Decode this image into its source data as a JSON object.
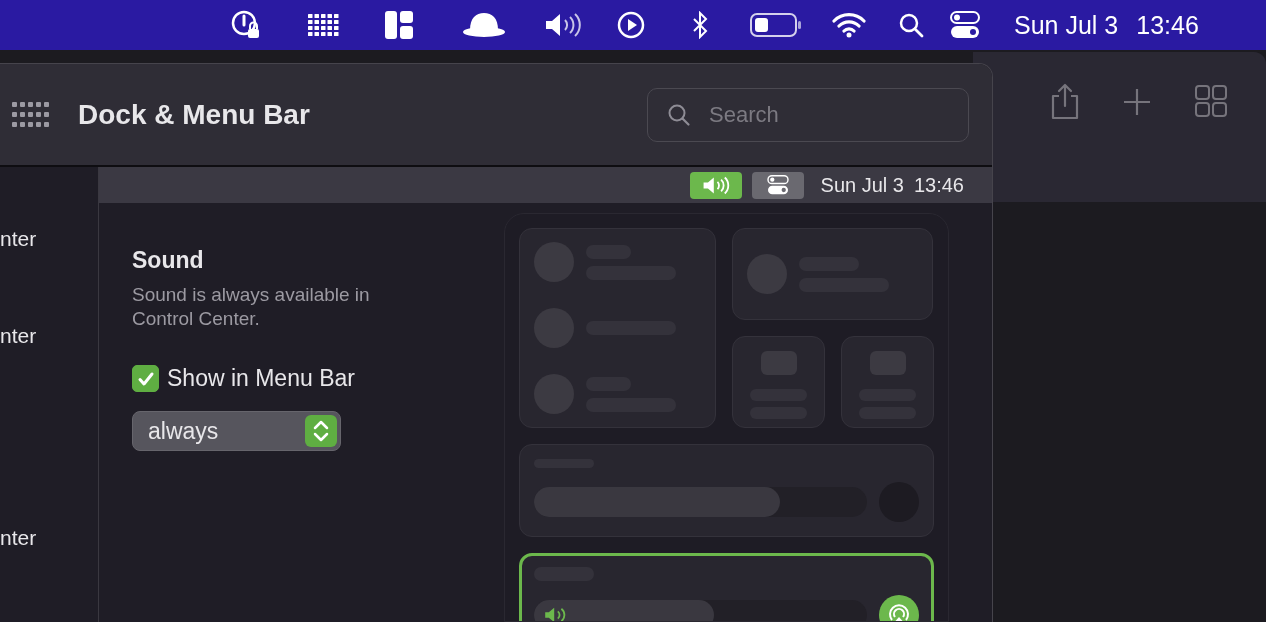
{
  "menu_bar": {
    "date": "Sun Jul 3",
    "time": "13:46"
  },
  "window": {
    "title": "Dock & Menu Bar",
    "search": {
      "placeholder": "Search"
    }
  },
  "sidebar_items": [
    {
      "label": "nter"
    },
    {
      "label": "nter"
    },
    {
      "label": "nter"
    }
  ],
  "preview_menu_bar": {
    "items": [
      {
        "kind": "sound",
        "selected": true
      },
      {
        "kind": "control-center",
        "selected": false
      }
    ],
    "date": "Sun Jul 3",
    "time": "13:46"
  },
  "section": {
    "title": "Sound",
    "description": "Sound is always available in Control Center.",
    "checkbox": {
      "label": "Show in Menu Bar",
      "checked": true
    },
    "popup": {
      "value": "always"
    }
  },
  "control_center_preview": {
    "display_slider": {
      "level": 0.74
    },
    "sound_module": {
      "selected": true,
      "level": 0.54
    }
  }
}
